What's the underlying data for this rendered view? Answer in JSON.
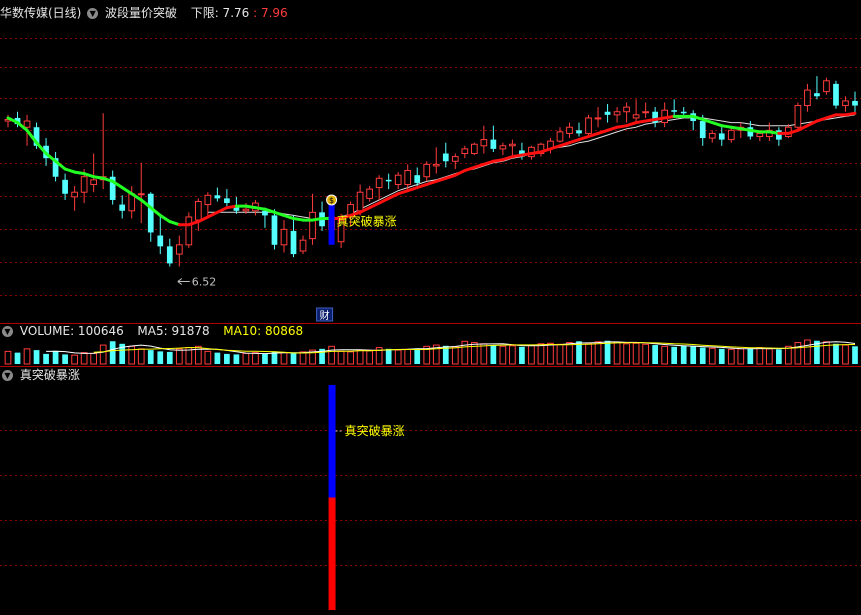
{
  "header": {
    "stock_name": "华数传媒(日线)",
    "indicator": "波段量价突破",
    "lower_label": "下限: 7.76",
    "lower_value2": ": 7.96"
  },
  "volume_header": {
    "label": "VOLUME: 100646",
    "ma5": "MA5: 91878",
    "ma10": "MA10: 80868"
  },
  "signal_header": {
    "label": "真突破暴涨"
  },
  "annotations": {
    "low_price": "6.52",
    "breakout_text": "真突破暴涨",
    "signal_text": "真突破暴涨",
    "finance_badge": "财",
    "coin_icon": "$"
  },
  "colors": {
    "up": "#ff3c3c",
    "down": "#54ffff",
    "grid": "#8b0000",
    "ma_green": "#22ff22",
    "ma_red": "#ff1010",
    "ma_white": "#e0e0e0",
    "signal_blue": "#0000ff",
    "signal_red": "#ff0000",
    "label_yellow": "#ffff00"
  },
  "chart_data": {
    "type": "candlestick",
    "ylim": [
      6.3,
      8.2
    ],
    "candles": [
      [
        7.56,
        7.6,
        7.52,
        7.57
      ],
      [
        7.58,
        7.62,
        7.52,
        7.54
      ],
      [
        7.52,
        7.6,
        7.4,
        7.56
      ],
      [
        7.52,
        7.55,
        7.38,
        7.4
      ],
      [
        7.4,
        7.45,
        7.27,
        7.32
      ],
      [
        7.32,
        7.36,
        7.17,
        7.2
      ],
      [
        7.18,
        7.22,
        7.05,
        7.09
      ],
      [
        7.07,
        7.14,
        6.98,
        7.1
      ],
      [
        7.1,
        7.25,
        7.03,
        7.2
      ],
      [
        7.15,
        7.35,
        7.1,
        7.18
      ],
      [
        7.18,
        7.61,
        7.12,
        7.2
      ],
      [
        7.2,
        7.24,
        7.02,
        7.05
      ],
      [
        7.02,
        7.08,
        6.93,
        6.98
      ],
      [
        6.98,
        7.14,
        6.93,
        7.09
      ],
      [
        7.09,
        7.29,
        6.9,
        7.09
      ],
      [
        7.09,
        7.1,
        6.78,
        6.84
      ],
      [
        6.82,
        6.96,
        6.7,
        6.75
      ],
      [
        6.75,
        6.8,
        6.62,
        6.64
      ],
      [
        6.7,
        6.82,
        6.62,
        6.76
      ],
      [
        6.76,
        6.97,
        6.74,
        6.94
      ],
      [
        6.92,
        7.06,
        6.85,
        7.04
      ],
      [
        7.02,
        7.1,
        6.95,
        7.08
      ],
      [
        7.08,
        7.13,
        7.04,
        7.06
      ],
      [
        7.06,
        7.12,
        7.01,
        7.03
      ],
      [
        7.01,
        7.07,
        6.96,
        6.98
      ],
      [
        6.98,
        7.03,
        6.96,
        6.99
      ],
      [
        6.98,
        7.05,
        6.95,
        7.03
      ],
      [
        6.98,
        7.0,
        6.87,
        6.95
      ],
      [
        6.95,
        6.99,
        6.73,
        6.76
      ],
      [
        6.76,
        6.92,
        6.71,
        6.86
      ],
      [
        6.85,
        6.95,
        6.68,
        6.7
      ],
      [
        6.72,
        6.82,
        6.7,
        6.79
      ],
      [
        6.8,
        7.09,
        6.76,
        6.97
      ],
      [
        6.97,
        7.04,
        6.85,
        6.88
      ],
      [
        6.86,
        6.98,
        6.79,
        6.94
      ],
      [
        6.78,
        6.96,
        6.74,
        6.92
      ],
      [
        6.94,
        7.04,
        6.88,
        7.02
      ],
      [
        6.98,
        7.15,
        6.95,
        7.1
      ],
      [
        7.06,
        7.14,
        7.04,
        7.12
      ],
      [
        7.13,
        7.21,
        7.05,
        7.19
      ],
      [
        7.18,
        7.22,
        7.12,
        7.17
      ],
      [
        7.15,
        7.23,
        7.12,
        7.21
      ],
      [
        7.15,
        7.28,
        7.12,
        7.24
      ],
      [
        7.21,
        7.26,
        7.13,
        7.16
      ],
      [
        7.2,
        7.3,
        7.17,
        7.28
      ],
      [
        7.27,
        7.39,
        7.22,
        7.28
      ],
      [
        7.35,
        7.42,
        7.26,
        7.3
      ],
      [
        7.3,
        7.35,
        7.25,
        7.33
      ],
      [
        7.35,
        7.4,
        7.32,
        7.38
      ],
      [
        7.35,
        7.42,
        7.34,
        7.41
      ],
      [
        7.4,
        7.53,
        7.35,
        7.44
      ],
      [
        7.44,
        7.53,
        7.36,
        7.38
      ],
      [
        7.38,
        7.42,
        7.34,
        7.4
      ],
      [
        7.4,
        7.44,
        7.33,
        7.41
      ],
      [
        7.37,
        7.42,
        7.31,
        7.33
      ],
      [
        7.33,
        7.4,
        7.31,
        7.39
      ],
      [
        7.35,
        7.42,
        7.33,
        7.41
      ],
      [
        7.38,
        7.45,
        7.35,
        7.43
      ],
      [
        7.43,
        7.52,
        7.42,
        7.49
      ],
      [
        7.48,
        7.55,
        7.45,
        7.52
      ],
      [
        7.5,
        7.55,
        7.46,
        7.48
      ],
      [
        7.48,
        7.6,
        7.45,
        7.58
      ],
      [
        7.58,
        7.65,
        7.52,
        7.58
      ],
      [
        7.62,
        7.67,
        7.55,
        7.6
      ],
      [
        7.6,
        7.65,
        7.55,
        7.62
      ],
      [
        7.62,
        7.68,
        7.55,
        7.65
      ],
      [
        7.58,
        7.7,
        7.55,
        7.6
      ],
      [
        7.62,
        7.68,
        7.58,
        7.62
      ],
      [
        7.62,
        7.65,
        7.52,
        7.55
      ],
      [
        7.55,
        7.68,
        7.52,
        7.63
      ],
      [
        7.63,
        7.7,
        7.58,
        7.62
      ],
      [
        7.62,
        7.65,
        7.6,
        7.61
      ],
      [
        7.61,
        7.63,
        7.5,
        7.56
      ],
      [
        7.56,
        7.6,
        7.4,
        7.45
      ],
      [
        7.45,
        7.5,
        7.42,
        7.48
      ],
      [
        7.48,
        7.52,
        7.4,
        7.44
      ],
      [
        7.44,
        7.52,
        7.42,
        7.5
      ],
      [
        7.5,
        7.55,
        7.45,
        7.52
      ],
      [
        7.52,
        7.56,
        7.44,
        7.46
      ],
      [
        7.46,
        7.5,
        7.43,
        7.48
      ],
      [
        7.46,
        7.55,
        7.43,
        7.5
      ],
      [
        7.5,
        7.52,
        7.4,
        7.44
      ],
      [
        7.46,
        7.54,
        7.45,
        7.52
      ],
      [
        7.52,
        7.68,
        7.5,
        7.66
      ],
      [
        7.66,
        7.8,
        7.62,
        7.76
      ],
      [
        7.74,
        7.85,
        7.7,
        7.72
      ],
      [
        7.75,
        7.84,
        7.73,
        7.82
      ],
      [
        7.8,
        7.82,
        7.64,
        7.66
      ],
      [
        7.66,
        7.72,
        7.62,
        7.69
      ],
      [
        7.69,
        7.75,
        7.6,
        7.66
      ]
    ],
    "ma_line": [
      7.58,
      7.55,
      7.5,
      7.42,
      7.35,
      7.3,
      7.25,
      7.23,
      7.22,
      7.2,
      7.19,
      7.17,
      7.13,
      7.09,
      7.05,
      7.0,
      6.95,
      6.91,
      6.89,
      6.89,
      6.91,
      6.94,
      6.97,
      7.0,
      7.01,
      7.01,
      7.0,
      6.99,
      6.97,
      6.95,
      6.93,
      6.92,
      6.92,
      6.93,
      6.93,
      6.93,
      6.95,
      6.97,
      7.0,
      7.03,
      7.06,
      7.09,
      7.11,
      7.13,
      7.15,
      7.17,
      7.19,
      7.21,
      7.24,
      7.26,
      7.28,
      7.3,
      7.31,
      7.33,
      7.34,
      7.35,
      7.36,
      7.38,
      7.4,
      7.42,
      7.44,
      7.46,
      7.48,
      7.5,
      7.52,
      7.53,
      7.55,
      7.56,
      7.57,
      7.58,
      7.59,
      7.59,
      7.59,
      7.57,
      7.55,
      7.53,
      7.52,
      7.51,
      7.5,
      7.49,
      7.49,
      7.48,
      7.48,
      7.5,
      7.53,
      7.56,
      7.58,
      7.6,
      7.6,
      7.61
    ],
    "ma_color": [
      "g",
      "g",
      "g",
      "g",
      "g",
      "g",
      "g",
      "g",
      "g",
      "g",
      "g",
      "g",
      "g",
      "g",
      "g",
      "g",
      "g",
      "g",
      "g",
      "r",
      "r",
      "r",
      "r",
      "r",
      "r",
      "g",
      "g",
      "g",
      "g",
      "g",
      "g",
      "g",
      "g",
      "g",
      "g",
      "r",
      "r",
      "r",
      "r",
      "r",
      "r",
      "r",
      "r",
      "r",
      "r",
      "r",
      "r",
      "r",
      "r",
      "r",
      "r",
      "r",
      "r",
      "r",
      "r",
      "r",
      "r",
      "r",
      "r",
      "r",
      "r",
      "r",
      "r",
      "r",
      "r",
      "r",
      "r",
      "r",
      "r",
      "r",
      "r",
      "g",
      "g",
      "g",
      "g",
      "g",
      "g",
      "g",
      "g",
      "g",
      "g",
      "g",
      "r",
      "r",
      "r",
      "r",
      "r",
      "r",
      "r",
      "r"
    ],
    "long_ma": [
      null,
      null,
      null,
      null,
      null,
      null,
      null,
      null,
      null,
      null,
      null,
      null,
      null,
      null,
      null,
      null,
      null,
      null,
      null,
      null,
      null,
      6.97,
      6.97,
      6.97,
      6.97,
      6.97,
      6.97,
      6.97,
      6.97,
      6.96,
      6.95,
      6.94,
      6.93,
      6.93,
      6.93,
      6.94,
      6.96,
      6.99,
      7.02,
      7.05,
      7.08,
      7.11,
      7.13,
      7.15,
      7.17,
      7.18,
      7.2,
      7.22,
      7.24,
      7.25,
      7.27,
      7.29,
      7.3,
      7.32,
      7.33,
      7.35,
      7.36,
      7.38,
      7.39,
      7.4,
      7.42,
      7.43,
      7.45,
      7.47,
      7.49,
      7.51,
      7.52,
      7.54,
      7.55,
      7.56,
      7.57,
      7.58,
      7.58,
      7.58,
      7.57,
      7.56,
      7.55,
      7.55,
      7.54,
      7.53,
      7.53,
      7.53,
      7.53,
      7.54,
      7.55,
      7.56,
      7.57,
      7.58,
      7.59,
      7.6
    ],
    "volume": [
      50,
      45,
      60,
      55,
      40,
      52,
      38,
      35,
      45,
      42,
      75,
      90,
      80,
      70,
      60,
      55,
      50,
      48,
      60,
      65,
      70,
      50,
      45,
      40,
      38,
      42,
      45,
      40,
      50,
      45,
      42,
      48,
      55,
      60,
      70,
      50,
      48,
      55,
      52,
      65,
      60,
      55,
      58,
      62,
      70,
      75,
      72,
      68,
      90,
      85,
      80,
      75,
      70,
      72,
      68,
      75,
      80,
      82,
      78,
      85,
      90,
      82,
      88,
      92,
      85,
      80,
      82,
      78,
      75,
      70,
      68,
      72,
      70,
      65,
      62,
      60,
      58,
      60,
      62,
      65,
      60,
      58,
      70,
      85,
      95,
      92,
      88,
      80,
      75,
      70
    ],
    "breakout_index": 34,
    "low_index": 17,
    "signal_bar": {
      "value": 1
    }
  }
}
